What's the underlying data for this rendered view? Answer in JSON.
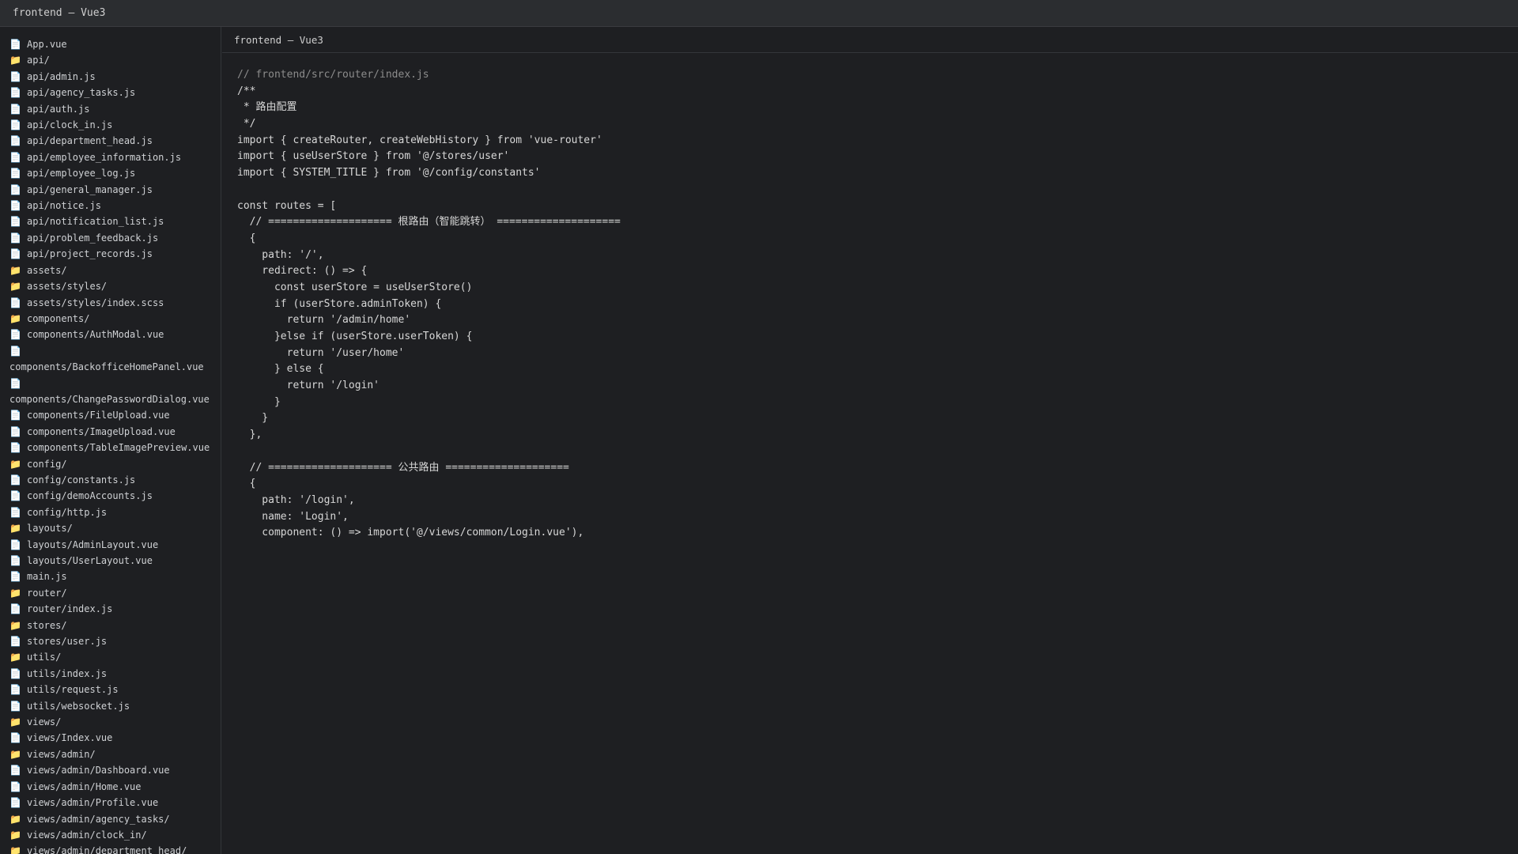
{
  "window": {
    "title": "frontend — Vue3"
  },
  "editor": {
    "tab_label": "frontend — Vue3",
    "lines": [
      "// frontend/src/router/index.js",
      "/**",
      " * 路由配置",
      " */",
      "import { createRouter, createWebHistory } from 'vue-router'",
      "import { useUserStore } from '@/stores/user'",
      "import { SYSTEM_TITLE } from '@/config/constants'",
      "",
      "const routes = [",
      "  // ==================== 根路由（智能跳转） ====================",
      "  {",
      "    path: '/',",
      "    redirect: () => {",
      "      const userStore = useUserStore()",
      "      if (userStore.adminToken) {",
      "        return '/admin/home'",
      "      }else if (userStore.userToken) {",
      "        return '/user/home'",
      "      } else {",
      "        return '/login'",
      "      }",
      "    }",
      "  },",
      "",
      "  // ==================== 公共路由 ====================",
      "  {",
      "    path: '/login',",
      "    name: 'Login',",
      "    component: () => import('@/views/common/Login.vue'),"
    ]
  },
  "sidebar": {
    "items": [
      {
        "type": "file",
        "icon": "file-icon",
        "label": "App.vue"
      },
      {
        "type": "folder",
        "icon": "folder-icon",
        "label": "api/"
      },
      {
        "type": "file",
        "icon": "file-icon",
        "label": "api/admin.js"
      },
      {
        "type": "file",
        "icon": "file-icon",
        "label": "api/agency_tasks.js"
      },
      {
        "type": "file",
        "icon": "file-icon",
        "label": "api/auth.js"
      },
      {
        "type": "file",
        "icon": "file-icon",
        "label": "api/clock_in.js"
      },
      {
        "type": "file",
        "icon": "file-icon",
        "label": "api/department_head.js"
      },
      {
        "type": "file",
        "icon": "file-icon",
        "label": "api/employee_information.js"
      },
      {
        "type": "file",
        "icon": "file-icon",
        "label": "api/employee_log.js"
      },
      {
        "type": "file",
        "icon": "file-icon",
        "label": "api/general_manager.js"
      },
      {
        "type": "file",
        "icon": "file-icon",
        "label": "api/notice.js"
      },
      {
        "type": "file",
        "icon": "file-icon",
        "label": "api/notification_list.js"
      },
      {
        "type": "file",
        "icon": "file-icon",
        "label": "api/problem_feedback.js"
      },
      {
        "type": "file",
        "icon": "file-icon",
        "label": "api/project_records.js"
      },
      {
        "type": "folder",
        "icon": "folder-icon",
        "label": "assets/"
      },
      {
        "type": "folder",
        "icon": "folder-icon",
        "label": "assets/styles/"
      },
      {
        "type": "file",
        "icon": "file-icon",
        "label": "assets/styles/index.scss"
      },
      {
        "type": "folder",
        "icon": "folder-icon",
        "label": "components/"
      },
      {
        "type": "file",
        "icon": "file-icon",
        "label": "components/AuthModal.vue"
      },
      {
        "type": "file",
        "icon": "file-icon",
        "label": "components/BackofficeHomePanel.vue",
        "wrap": true
      },
      {
        "type": "file",
        "icon": "file-icon",
        "label": "components/ChangePasswordDialog.vue",
        "wrap": true
      },
      {
        "type": "file",
        "icon": "file-icon",
        "label": "components/FileUpload.vue"
      },
      {
        "type": "file",
        "icon": "file-icon",
        "label": "components/ImageUpload.vue"
      },
      {
        "type": "file",
        "icon": "file-icon",
        "label": "components/TableImagePreview.vue"
      },
      {
        "type": "folder",
        "icon": "folder-icon",
        "label": "config/"
      },
      {
        "type": "file",
        "icon": "file-icon",
        "label": "config/constants.js"
      },
      {
        "type": "file",
        "icon": "file-icon",
        "label": "config/demoAccounts.js"
      },
      {
        "type": "file",
        "icon": "file-icon",
        "label": "config/http.js"
      },
      {
        "type": "folder",
        "icon": "folder-icon",
        "label": "layouts/"
      },
      {
        "type": "file",
        "icon": "file-icon",
        "label": "layouts/AdminLayout.vue"
      },
      {
        "type": "file",
        "icon": "file-icon",
        "label": "layouts/UserLayout.vue"
      },
      {
        "type": "file",
        "icon": "file-icon",
        "label": "main.js"
      },
      {
        "type": "folder",
        "icon": "folder-icon",
        "label": "router/"
      },
      {
        "type": "file",
        "icon": "file-icon",
        "label": "router/index.js"
      },
      {
        "type": "folder",
        "icon": "folder-icon",
        "label": "stores/"
      },
      {
        "type": "file",
        "icon": "file-icon",
        "label": "stores/user.js"
      },
      {
        "type": "folder",
        "icon": "folder-icon",
        "label": "utils/"
      },
      {
        "type": "file",
        "icon": "file-icon",
        "label": "utils/index.js"
      },
      {
        "type": "file",
        "icon": "file-icon",
        "label": "utils/request.js"
      },
      {
        "type": "file",
        "icon": "file-icon",
        "label": "utils/websocket.js"
      },
      {
        "type": "folder",
        "icon": "folder-icon",
        "label": "views/"
      },
      {
        "type": "file",
        "icon": "file-icon",
        "label": "views/Index.vue"
      },
      {
        "type": "folder",
        "icon": "folder-icon",
        "label": "views/admin/"
      },
      {
        "type": "file",
        "icon": "file-icon",
        "label": "views/admin/Dashboard.vue"
      },
      {
        "type": "file",
        "icon": "file-icon",
        "label": "views/admin/Home.vue"
      },
      {
        "type": "file",
        "icon": "file-icon",
        "label": "views/admin/Profile.vue"
      },
      {
        "type": "folder",
        "icon": "folder-icon",
        "label": "views/admin/agency_tasks/"
      },
      {
        "type": "folder",
        "icon": "folder-icon",
        "label": "views/admin/clock_in/"
      },
      {
        "type": "folder",
        "icon": "folder-icon",
        "label": "views/admin/department_head/"
      }
    ]
  }
}
